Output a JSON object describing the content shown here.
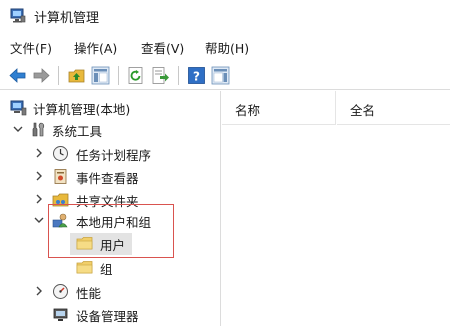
{
  "window": {
    "title": "计算机管理"
  },
  "menu": {
    "file": "文件(F)",
    "action": "操作(A)",
    "view": "查看(V)",
    "help": "帮助(H)"
  },
  "toolbar": {
    "buttons": [
      "back-icon",
      "forward-icon",
      "up-folder-icon",
      "show-hide-tree-icon",
      "refresh-icon",
      "export-list-icon",
      "help-icon",
      "action-pane-icon"
    ]
  },
  "tree": {
    "root": "计算机管理(本地)",
    "system_tools": "系统工具",
    "task_scheduler": "任务计划程序",
    "event_viewer": "事件查看器",
    "shared_folders": "共享文件夹",
    "local_users_groups": "本地用户和组",
    "users": "用户",
    "groups": "组",
    "performance": "性能",
    "device_manager": "设备管理器"
  },
  "list": {
    "columns": [
      "名称",
      "全名"
    ]
  },
  "colors": {
    "highlight_border": "#d9534f",
    "selected_bg": "#e3e3e3"
  }
}
